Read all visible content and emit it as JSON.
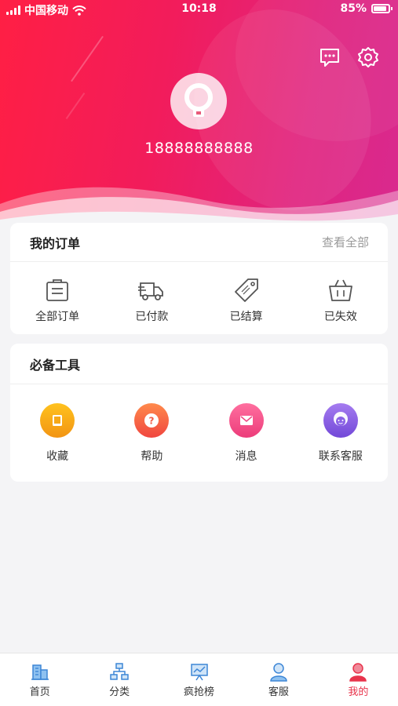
{
  "status_bar": {
    "carrier": "中国移动",
    "time": "10:18",
    "battery": "85%"
  },
  "profile": {
    "phone": "18888888888"
  },
  "orders": {
    "title": "我的订单",
    "view_all": "查看全部",
    "items": [
      {
        "label": "全部订单",
        "icon": "clipboard-icon"
      },
      {
        "label": "已付款",
        "icon": "truck-icon"
      },
      {
        "label": "已结算",
        "icon": "tag-icon"
      },
      {
        "label": "已失效",
        "icon": "basket-icon"
      }
    ]
  },
  "tools": {
    "title": "必备工具",
    "items": [
      {
        "label": "收藏",
        "icon": "favorite-icon",
        "color": "#f7a21b"
      },
      {
        "label": "帮助",
        "icon": "help-icon",
        "color": "#f3634a"
      },
      {
        "label": "消息",
        "icon": "mail-icon",
        "color": "#f04c86"
      },
      {
        "label": "联系客服",
        "icon": "service-icon",
        "color": "#8a62e6"
      }
    ]
  },
  "tabbar": {
    "items": [
      {
        "label": "首页",
        "icon": "home-building-icon"
      },
      {
        "label": "分类",
        "icon": "category-tree-icon"
      },
      {
        "label": "疯抢榜",
        "icon": "ranking-board-icon"
      },
      {
        "label": "客服",
        "icon": "customer-service-icon"
      },
      {
        "label": "我的",
        "icon": "profile-icon"
      }
    ],
    "active": "我的",
    "active_color": "#e8344c",
    "inactive_icon_color": "#4a90d9"
  },
  "colors": {
    "header_start": "#ff1f44",
    "header_end": "#d92a8f"
  }
}
